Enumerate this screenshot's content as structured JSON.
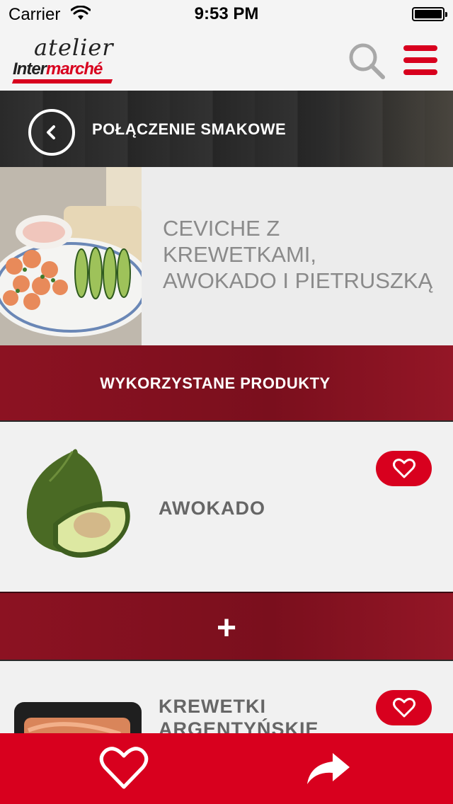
{
  "status_bar": {
    "carrier": "Carrier",
    "time": "9:53 PM",
    "battery_level": 1.0
  },
  "logo": {
    "line1": "atelier",
    "line2_a": "Inter",
    "line2_b": "marché"
  },
  "header": {
    "title": "POŁĄCZENIE SMAKOWE"
  },
  "recipe": {
    "title_lines": [
      "CEVICHE Z",
      "KREWETKAMI,",
      "AWOKADO I PIETRUSZKĄ"
    ]
  },
  "products_section": {
    "title": "WYKORZYSTANE PRODUKTY"
  },
  "products": [
    {
      "name": "AWOKADO"
    },
    {
      "name_lines": [
        "KREWETKI",
        "ARGENTYŃSKIE"
      ]
    }
  ],
  "separator": {
    "symbol": "+"
  },
  "icons": {
    "search": "search-icon",
    "menu": "hamburger-menu-icon",
    "back": "chevron-left-icon",
    "favorite": "heart-outline-icon",
    "share": "share-arrow-icon"
  },
  "colors": {
    "accent": "#d8001e",
    "band": "#7a0f1d",
    "header": "#2e2e2e",
    "text_muted": "#8a8a8a"
  }
}
